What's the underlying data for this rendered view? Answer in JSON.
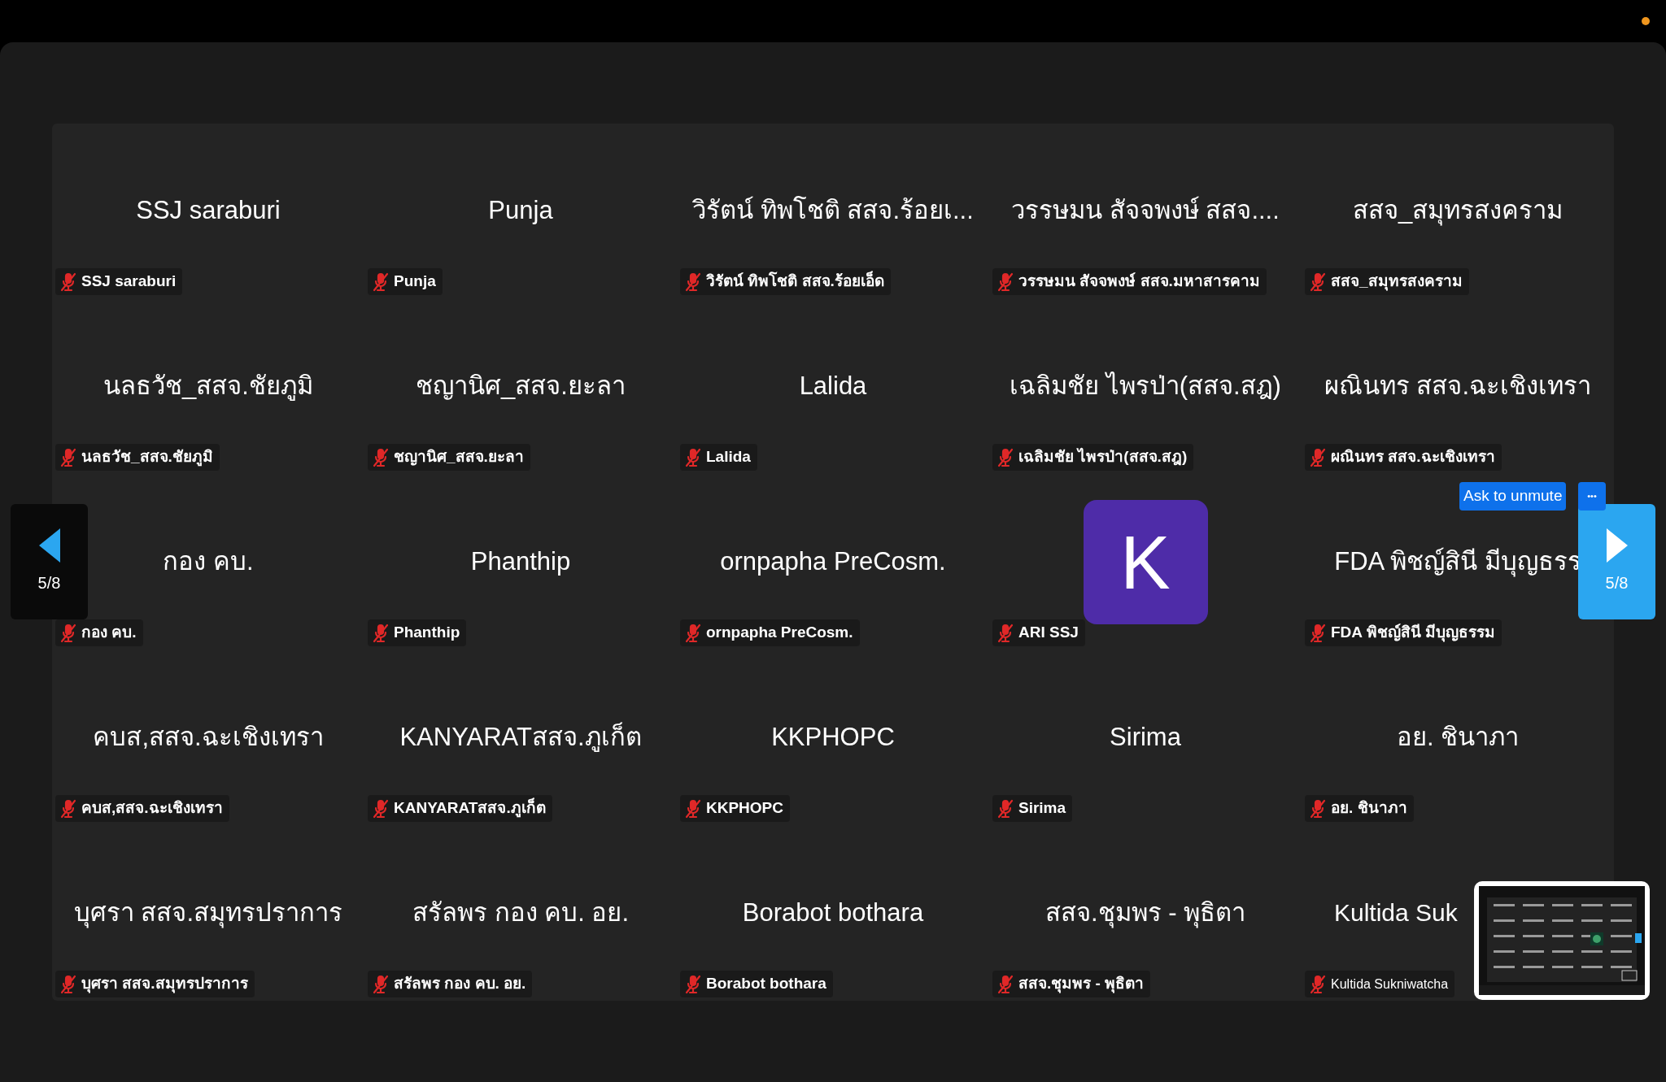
{
  "pager": {
    "previous": "5/8",
    "next": "5/8"
  },
  "tiles": [
    {
      "kind": "name",
      "name": "SSJ saraburi",
      "label": "SSJ saraburi",
      "muted": true
    },
    {
      "kind": "name",
      "name": "Punja",
      "label": "Punja",
      "muted": true
    },
    {
      "kind": "name",
      "name": "วิรัตน์ ทิพโชติ สสจ.ร้อยเ...",
      "label": "วิรัตน์ ทิพโชติ สสจ.ร้อยเอ็ด",
      "muted": true
    },
    {
      "kind": "name",
      "name": "วรรษมน สัจจพงษ์ สสจ....",
      "label": "วรรษมน สัจจพงษ์ สสจ.มหาสารคาม",
      "muted": true
    },
    {
      "kind": "name",
      "name": "สสจ_สมุทรสงคราม",
      "label": "สสจ_สมุทรสงคราม",
      "muted": true
    },
    {
      "kind": "name",
      "name": "นลธวัช_สสจ.ชัยภูมิ",
      "label": "นลธวัช_สสจ.ชัยภูมิ",
      "muted": true
    },
    {
      "kind": "name",
      "name": "ชญานิศ_สสจ.ยะลา",
      "label": "ชญานิศ_สสจ.ยะลา",
      "muted": true
    },
    {
      "kind": "name",
      "name": "Lalida",
      "label": "Lalida",
      "muted": true
    },
    {
      "kind": "name",
      "name": "เฉลิมชัย ไพรป่า(สสจ.สฎ)",
      "label": "เฉลิมชัย ไพรป่า(สสจ.สฎ)",
      "muted": true
    },
    {
      "kind": "name",
      "name": "ผณินทร สสจ.ฉะเชิงเทรา",
      "label": "ผณินทร สสจ.ฉะเชิงเทรา",
      "muted": true
    },
    {
      "kind": "name",
      "name": "กอง คบ.",
      "label": "กอง คบ.",
      "muted": true
    },
    {
      "kind": "name",
      "name": "Phanthip",
      "label": "Phanthip",
      "muted": true
    },
    {
      "kind": "name",
      "name": "ornpapha PreCosm.",
      "label": "ornpapha PreCosm.",
      "muted": true
    },
    {
      "kind": "avatar",
      "initial": "K",
      "color": "#4e2ca8",
      "label": "ARI SSJ",
      "muted": true
    },
    {
      "kind": "name",
      "name": "FDA พิชญ์สินี มีบุญธรร",
      "label": "FDA พิชญ์สินี มีบุญธรรม",
      "muted": true
    },
    {
      "kind": "name",
      "name": "คบส,สสจ.ฉะเชิงเทรา",
      "label": "คบส,สสจ.ฉะเชิงเทรา",
      "muted": true
    },
    {
      "kind": "name",
      "name": "KANYARATสสจ.ภูเก็ต",
      "label": "KANYARATสสจ.ภูเก็ต",
      "muted": true
    },
    {
      "kind": "name",
      "name": "KKPHOPC",
      "label": "KKPHOPC",
      "muted": true
    },
    {
      "kind": "name",
      "name": "Sirima",
      "label": "Sirima",
      "muted": true
    },
    {
      "kind": "name",
      "name": "อย. ชินาภา",
      "label": "อย. ชินาภา",
      "muted": true
    },
    {
      "kind": "name",
      "name": "บุศรา สสจ.สมุทรปราการ",
      "label": "บุศรา สสจ.สมุทรปราการ",
      "muted": true
    },
    {
      "kind": "name",
      "name": "สรัลพร กอง คบ. อย.",
      "label": "สรัลพร กอง คบ. อย.",
      "muted": true
    },
    {
      "kind": "name",
      "name": "Borabot bothara",
      "label": "Borabot bothara",
      "muted": true
    },
    {
      "kind": "name",
      "name": "สสจ.ชุมพร - พุธิตา",
      "label": "สสจ.ชุมพร - พุธิตา",
      "muted": true
    },
    {
      "kind": "name",
      "name": "Kultida Suk",
      "label": "Kultida Sukniwatcha",
      "muted": true
    }
  ],
  "hover_actions": {
    "ask_button": "Ask to unmute",
    "more_button": "•••"
  }
}
